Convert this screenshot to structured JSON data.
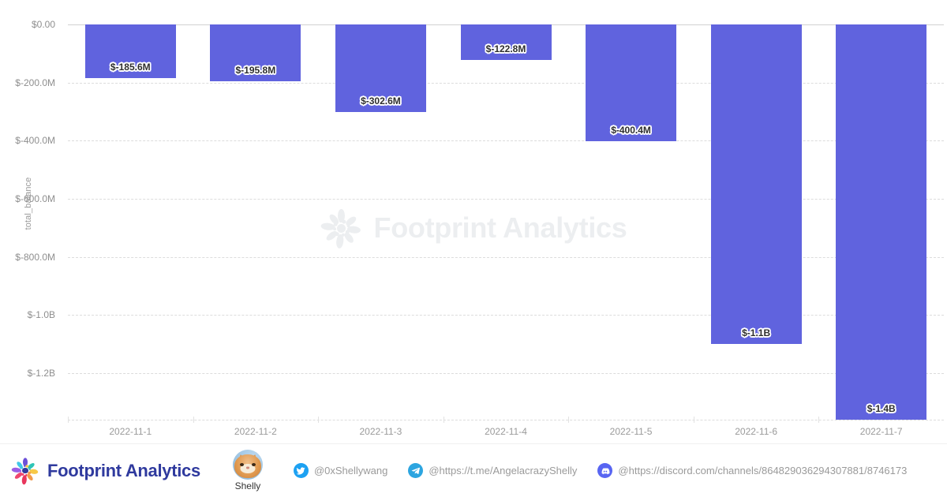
{
  "chart_data": {
    "type": "bar",
    "title": "",
    "subtitle": "",
    "xlabel": "",
    "ylabel": "total_balance",
    "categories": [
      "2022-11-1",
      "2022-11-2",
      "2022-11-3",
      "2022-11-4",
      "2022-11-5",
      "2022-11-6",
      "2022-11-7"
    ],
    "values": [
      -185600000,
      -195800000,
      -302600000,
      -122800000,
      -400400000,
      -1100000000,
      -1400000000
    ],
    "data_labels": [
      "$-185.6M",
      "$-195.8M",
      "$-302.6M",
      "$-122.8M",
      "$-400.4M",
      "$-1.1B",
      "$-1.4B"
    ],
    "series": [
      {
        "name": "total_balance",
        "color": "#6063de",
        "values": [
          -185600000,
          -195800000,
          -302600000,
          -122800000,
          -400400000,
          -1100000000,
          -1400000000
        ]
      }
    ],
    "ylim": [
      -1360000000,
      0
    ],
    "ytick_values": [
      0,
      -200000000,
      -400000000,
      -600000000,
      -800000000,
      -1000000000,
      -1200000000
    ],
    "ytick_labels": [
      "$0.00",
      "$-200.0M",
      "$-400.0M",
      "$-600.0M",
      "$-800.0M",
      "$-1.0B",
      "$-1.2B"
    ],
    "grid": true,
    "grid_style": "dashed",
    "legend": "none",
    "orientation": "vertical",
    "note": "Last bar is clipped by the bottom axis; value extends below the plotted range."
  },
  "watermark": {
    "text": "Footprint Analytics",
    "color": "#eceef0",
    "logo_icon": "footprint-flower-logo"
  },
  "footer": {
    "brand": {
      "name": "Footprint Analytics",
      "color": "#2f3a9e",
      "logo_icon": "footprint-flower-logo"
    },
    "person": {
      "name": "Shelly",
      "avatar_icon": "cat-avatar"
    },
    "links": [
      {
        "icon": "twitter-icon",
        "handle": "@0xShellywang"
      },
      {
        "icon": "telegram-icon",
        "handle": "@https://t.me/AngelacrazyShelly"
      },
      {
        "icon": "discord-icon",
        "handle": "@https://discord.com/channels/864829036294307881/8746173"
      }
    ]
  },
  "theme": {
    "bar_color": "#6063de",
    "grid_color": "#dcdcdc",
    "axis_text_color": "#9a9a9a",
    "background": "#ffffff"
  }
}
